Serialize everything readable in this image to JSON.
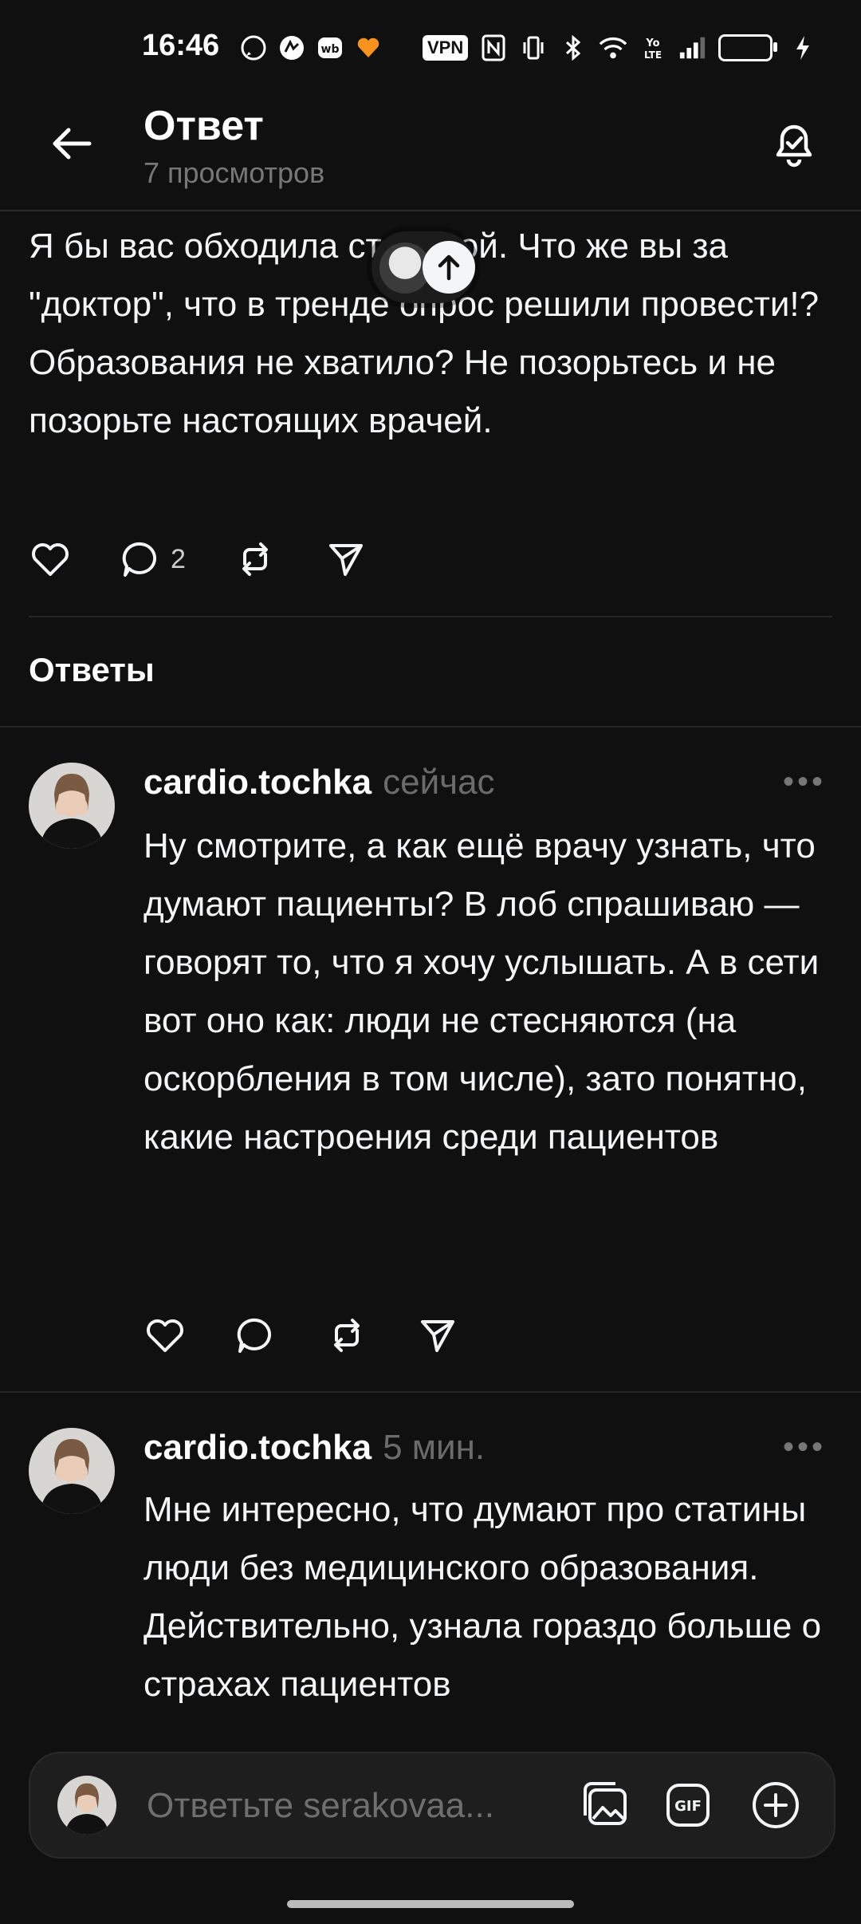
{
  "status_bar": {
    "time": "16:46",
    "vpn_label": "VPN",
    "icons": [
      "whatsapp-icon",
      "app-icon",
      "wb-icon",
      "heart-app-icon",
      "nfc-icon",
      "vibrate-icon",
      "bluetooth-icon",
      "wifi-icon",
      "volte-icon",
      "signal-icon",
      "battery-icon",
      "charging-icon"
    ]
  },
  "header": {
    "title": "Ответ",
    "subtitle": "7 просмотров"
  },
  "parent_post": {
    "text": "Я бы вас обходила стороной. Что же вы за \"доктор\", что в тренде опрос решили провести!? Образования не хватило? Не позорьтесь и не позорьте настоящих врачей.",
    "reply_count": "2"
  },
  "replies_heading": "Ответы",
  "replies": [
    {
      "username": "cardio.tochka",
      "time": "сейчас",
      "text": "Ну смотрите, а как ещё врачу узнать, что думают пациенты? В лоб спрашиваю — говорят то, что я хочу услышать. А в сети вот оно как: люди не стесняются (на оскорбления в том числе), зато понятно, какие настроения среди пациентов"
    },
    {
      "username": "cardio.tochka",
      "time": "5 мин.",
      "text": "Мне интересно, что думают про статины люди без медицинского образования. Действительно, узнала гораздо больше о страхах пациентов"
    }
  ],
  "composer": {
    "placeholder": "Ответьте serakovaa..."
  },
  "colors": {
    "background": "#101010",
    "text": "#f3f5f7",
    "muted": "#6b6b6b"
  }
}
